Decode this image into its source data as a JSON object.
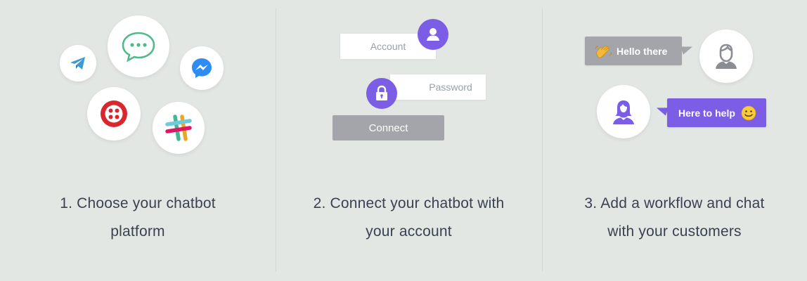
{
  "steps": [
    {
      "caption_line1": "1. Choose your chatbot",
      "caption_line2": "platform",
      "platforms": [
        "telegram-icon",
        "chat-icon",
        "messenger-icon",
        "twilio-icon",
        "slack-icon"
      ]
    },
    {
      "caption_line1": "2. Connect your chatbot with",
      "caption_line2": "your account",
      "account_placeholder": "Account",
      "password_placeholder": "Password",
      "connect_label": "Connect"
    },
    {
      "caption_line1": "3. Add a workflow and chat",
      "caption_line2": "with your customers",
      "greeting": "Hello there",
      "reply": "Here to help"
    }
  ],
  "colors": {
    "background": "#e3e7e4",
    "accent": "#7b5de6",
    "gray_button": "#a3a5aa",
    "text": "#3a4150"
  }
}
